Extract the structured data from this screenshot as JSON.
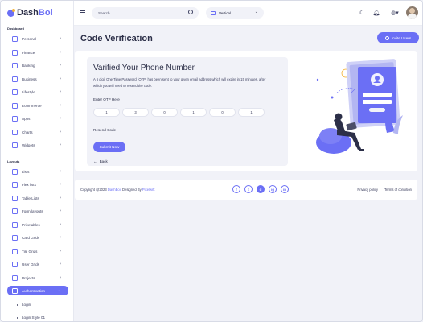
{
  "app": {
    "logo_prefix": "Dash",
    "logo_suffix": "Boi"
  },
  "sidebar": {
    "section_dashboard": "Dashboard",
    "section_layouts": "Layouts",
    "dashboard_items": [
      {
        "label": "Personal",
        "icon": "home-icon"
      },
      {
        "label": "Finance",
        "icon": "finance-icon"
      },
      {
        "label": "Banking",
        "icon": "bank-icon"
      },
      {
        "label": "Business",
        "icon": "briefcase-icon"
      },
      {
        "label": "Lifestyle",
        "icon": "lifestyle-icon"
      },
      {
        "label": "Ecommerce",
        "icon": "cart-icon"
      },
      {
        "label": "Apps",
        "icon": "apps-icon"
      },
      {
        "label": "Charts",
        "icon": "chart-icon"
      },
      {
        "label": "Widgets",
        "icon": "widgets-icon"
      }
    ],
    "layout_items": [
      {
        "label": "Lists",
        "icon": "list-icon"
      },
      {
        "label": "Flex lists",
        "icon": "flex-list-icon"
      },
      {
        "label": "Table Lists",
        "icon": "table-icon"
      },
      {
        "label": "Form layouts",
        "icon": "form-icon"
      },
      {
        "label": "Pricetables",
        "icon": "price-icon"
      },
      {
        "label": "Card Grids",
        "icon": "card-grid-icon"
      },
      {
        "label": "Tile Grids",
        "icon": "tile-grid-icon"
      },
      {
        "label": "User Grids",
        "icon": "user-grid-icon"
      },
      {
        "label": "Projects",
        "icon": "project-icon"
      },
      {
        "label": "Authentication",
        "icon": "auth-icon"
      }
    ],
    "sub_items": [
      "Login",
      "Login Style 01"
    ]
  },
  "topbar": {
    "search_placeholder": "Search",
    "layout_value": "Vertical",
    "icons": [
      "moon-icon",
      "bell-icon",
      "globe-icon"
    ]
  },
  "page": {
    "title": "Code Verification",
    "invite_label": "Invite Users",
    "verify_title": "Varified Your Phone Number",
    "verify_desc": "A 6 digit One Time Password (OTP) has been sent to your given email address which will expire in 15 minutes, after which you will need to resend the code.",
    "otp_label": "Enter OTP Here",
    "otp_values": [
      "1",
      "3",
      "0",
      "1",
      "0",
      "1"
    ],
    "resend_label": "Resend Code",
    "submit_label": "Submit Now",
    "back_label": "Back"
  },
  "footer": {
    "copy_prefix": "Copyright @2023 ",
    "copy_brand": "DashBoi",
    "copy_mid": ". Designed By ",
    "copy_author": "Pixelwrk",
    "links": [
      "Privacy policy",
      "Terms of condition"
    ],
    "social": [
      "f",
      "t",
      "d",
      "ig",
      "in"
    ]
  },
  "colors": {
    "accent": "#6b6ff5",
    "warning": "#f3b234",
    "text": "#2c2f48",
    "bg": "#f1f2f8"
  }
}
